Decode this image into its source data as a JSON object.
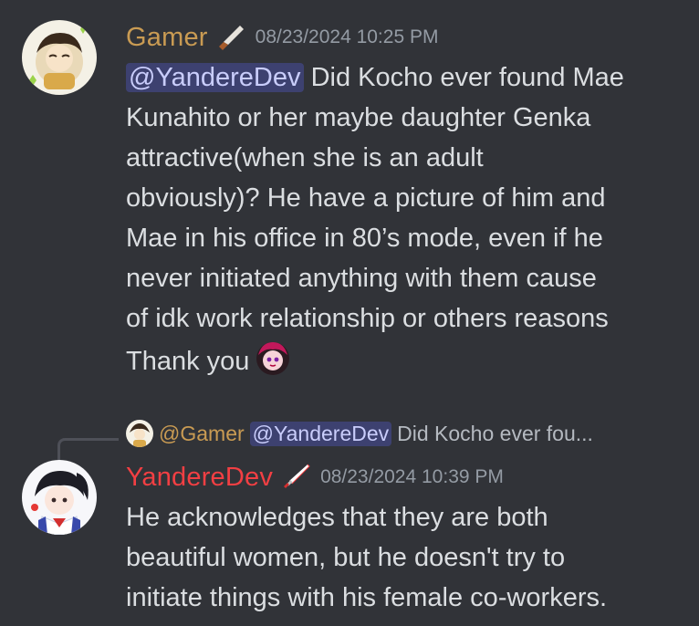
{
  "messages": [
    {
      "author": "Gamer",
      "author_color": "#c99b53",
      "role_icon": "knife-icon",
      "timestamp": "08/23/2024 10:25 PM",
      "mention": "@YandereDev",
      "lines": [
        "Did Kocho ever found Mae",
        "Kunahito or her maybe daughter Genka",
        "attractive(when she is an adult",
        "obviously)? He have a picture of him and",
        "Mae in his office in 80’s mode, even if he",
        "never initiated anything with them cause",
        "of idk work relationship or others reasons",
        "Thank you"
      ],
      "trailing_emoji": "anime-girl-emoji"
    },
    {
      "author": "YandereDev",
      "author_color": "#f23f43",
      "role_icon": "katana-icon",
      "timestamp": "08/23/2024 10:39 PM",
      "lines": [
        "He acknowledges that they are both",
        "beautiful women, but he doesn't try to",
        "initiate things with his female co-workers."
      ]
    }
  ],
  "reply": {
    "author": "@Gamer",
    "mention": "@YandereDev",
    "preview": "Did Kocho ever fou..."
  },
  "colors": {
    "background": "#313338",
    "text": "#dbdee1",
    "mention_bg": "#3c4270",
    "mention_text": "#c9cdfb",
    "muted": "#949ba4"
  }
}
